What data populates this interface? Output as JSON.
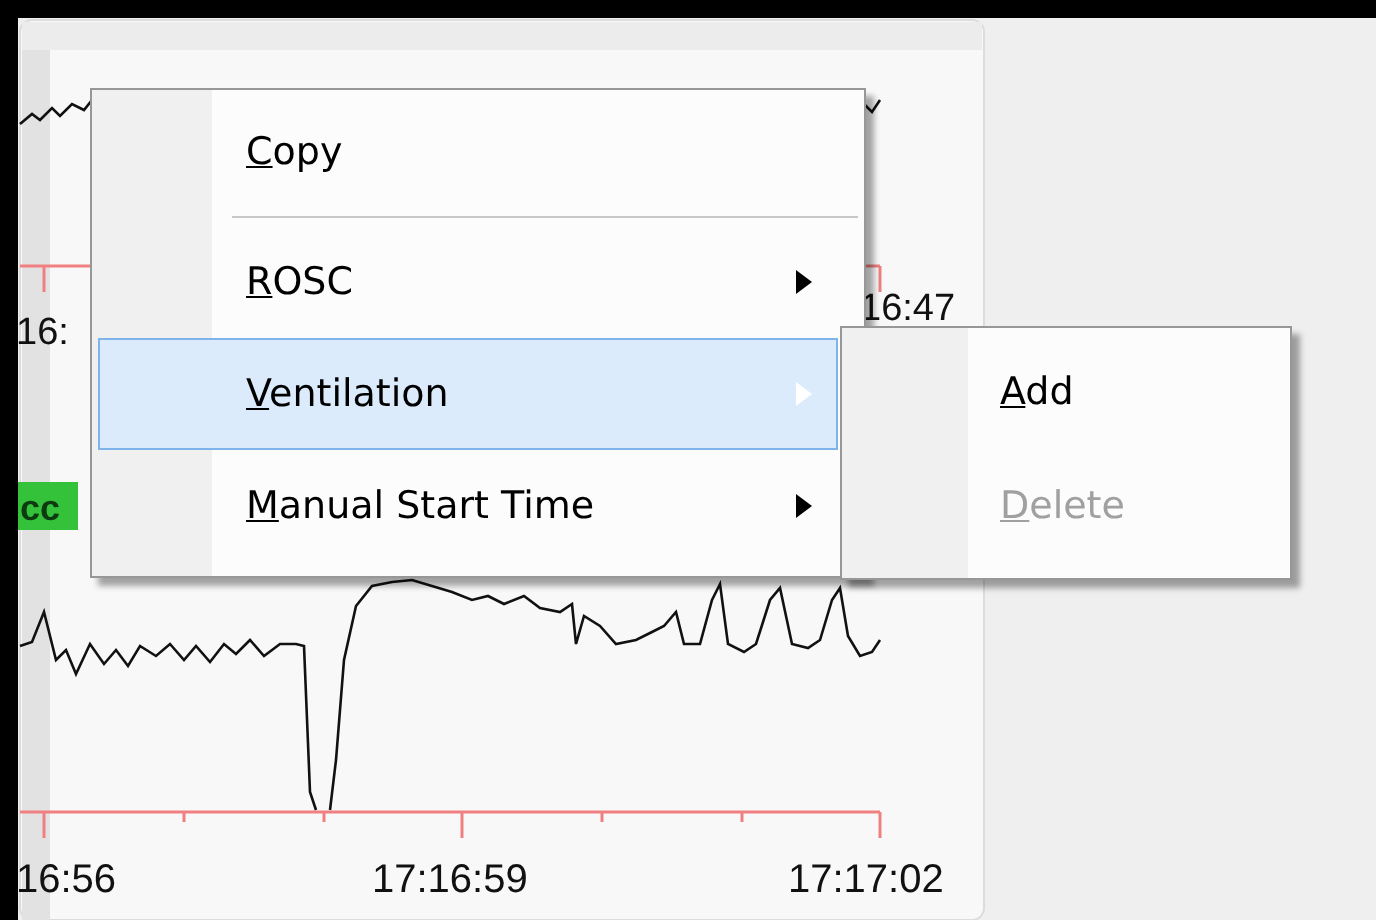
{
  "chart_panel": {
    "time_labels_top": [
      "16:",
      "16:47"
    ],
    "event_badge": "cc",
    "time_labels_bottom": [
      "16:56",
      "17:16:59",
      "17:17:02"
    ]
  },
  "context_menu": {
    "items": [
      {
        "kind": "command",
        "label": "Copy",
        "selected": false,
        "has_submenu": false
      },
      {
        "kind": "separator"
      },
      {
        "kind": "command",
        "label": "ROSC",
        "selected": false,
        "has_submenu": true
      },
      {
        "kind": "command",
        "label": "Ventilation",
        "selected": true,
        "has_submenu": true
      },
      {
        "kind": "command",
        "label": "Manual Start Time",
        "selected": false,
        "has_submenu": true
      }
    ]
  },
  "submenu": {
    "items": [
      {
        "label": "Add",
        "disabled": false
      },
      {
        "label": "Delete",
        "disabled": true
      }
    ]
  }
}
